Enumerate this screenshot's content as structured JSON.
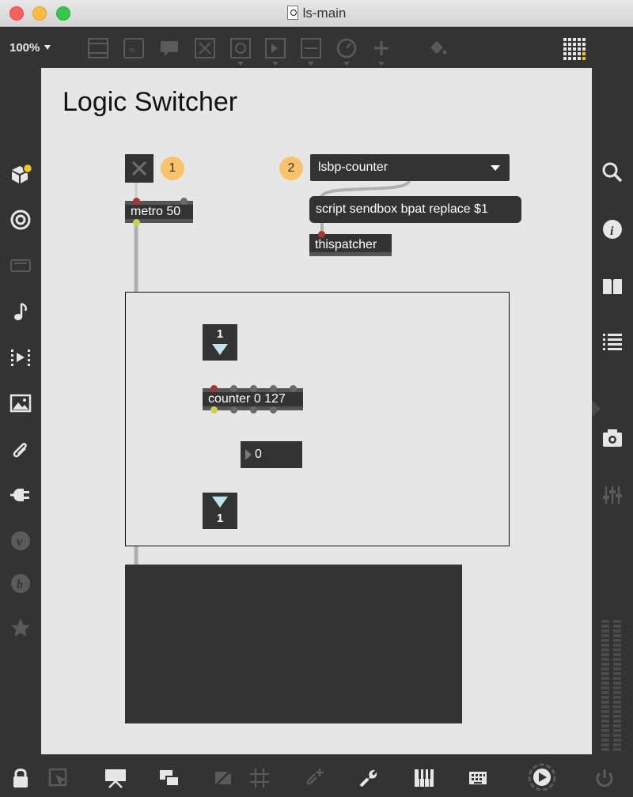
{
  "window": {
    "title": "ls-main"
  },
  "toolbar": {
    "zoom": "100%"
  },
  "canvas": {
    "heading": "Logic Switcher",
    "badges": [
      "1",
      "2"
    ],
    "metro": "metro 50",
    "menu": {
      "selected": "lsbp-counter"
    },
    "message": "script sendbox bpat replace $1",
    "thispatcher": "thispatcher",
    "bpatcher": {
      "top_number": "1",
      "counter": "counter 0 127",
      "number_box": "0",
      "bottom_number": "1"
    }
  },
  "colors": {
    "object_bg": "#333333",
    "canvas_bg": "#e6e6e6",
    "badge": "#f9c36b",
    "inlet_cyan": "#bde4ec",
    "notification_dot": "#f5c518"
  }
}
